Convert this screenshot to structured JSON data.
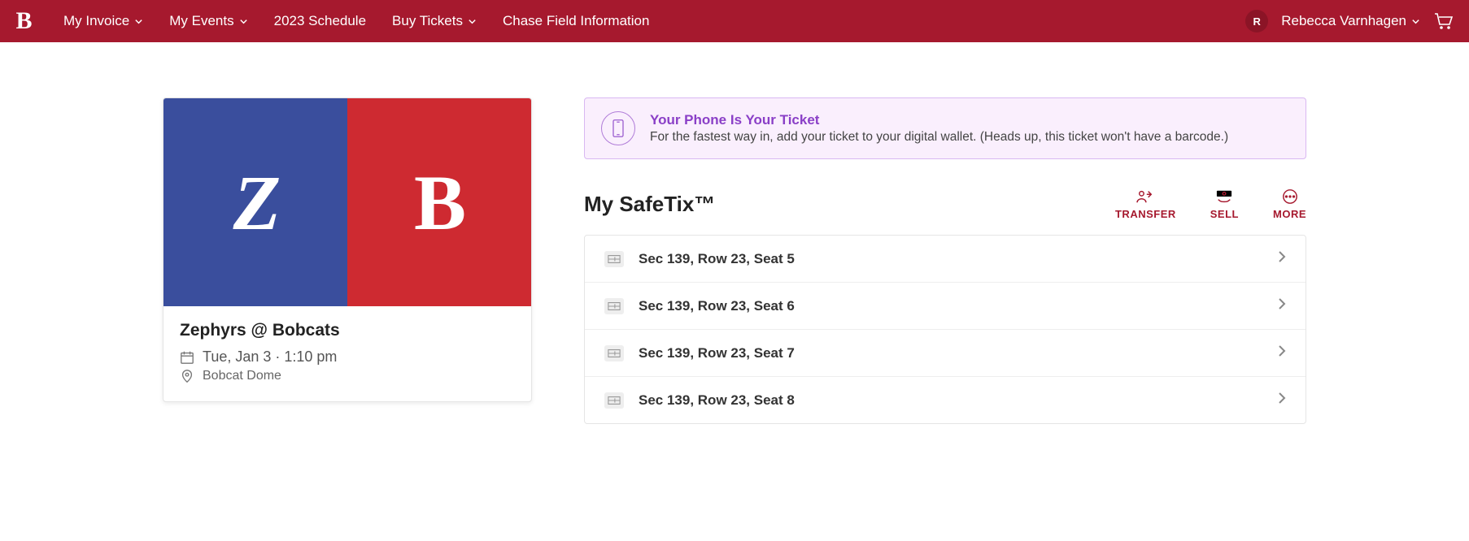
{
  "header": {
    "logo_letter": "B",
    "nav": [
      "My Invoice",
      "My Events",
      "2023 Schedule",
      "Buy Tickets",
      "Chase Field Information"
    ],
    "nav_has_dropdown": [
      true,
      true,
      false,
      true,
      false
    ],
    "user_initial": "R",
    "user_name": "Rebecca Varnhagen"
  },
  "event": {
    "away_letter": "Z",
    "home_letter": "B",
    "title": "Zephyrs @ Bobcats",
    "datetime": "Tue, Jan 3 · 1:10 pm",
    "venue": "Bobcat Dome"
  },
  "notice": {
    "title": "Your Phone Is Your Ticket",
    "body": "For the fastest way in, add your ticket to your digital wallet. (Heads up, this ticket won't have a barcode.)"
  },
  "safetix": {
    "heading": "My SafeTix™",
    "actions": {
      "transfer": "TRANSFER",
      "sell": "SELL",
      "more": "MORE"
    },
    "tickets": [
      "Sec 139, Row 23, Seat 5",
      "Sec 139, Row 23, Seat 6",
      "Sec 139, Row 23, Seat 7",
      "Sec 139, Row 23, Seat 8"
    ]
  }
}
